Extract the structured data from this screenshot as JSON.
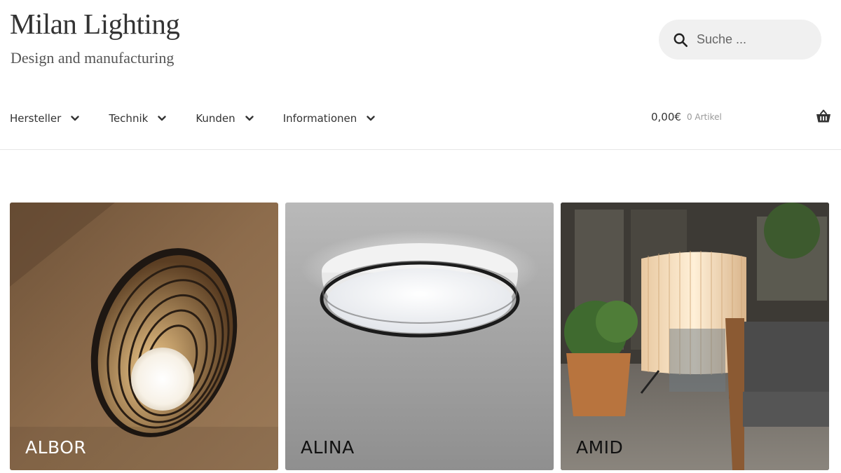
{
  "site": {
    "title": "Milan Lighting",
    "tagline": "Design and manufacturing"
  },
  "search": {
    "placeholder": "Suche ...",
    "value": "",
    "icon": "search-icon"
  },
  "nav": {
    "items": [
      {
        "label": "Hersteller",
        "icon": "chevron-down-icon"
      },
      {
        "label": "Technik",
        "icon": "chevron-down-icon"
      },
      {
        "label": "Kunden",
        "icon": "chevron-down-icon"
      },
      {
        "label": "Informationen",
        "icon": "chevron-down-icon"
      }
    ]
  },
  "cart": {
    "amount": "0,00€",
    "count": "0 Artikel",
    "icon": "basket-icon"
  },
  "products": [
    {
      "name": "ALBOR",
      "label_color": "#ffffff",
      "background": "#8a6a4a"
    },
    {
      "name": "ALINA",
      "label_color": "#111111",
      "background": "#9c9c9c"
    },
    {
      "name": "AMID",
      "label_color": "#111111",
      "background": "#4a4640"
    }
  ],
  "colors": {
    "text": "#333333",
    "muted": "#999999",
    "search_bg": "#f0f0f0",
    "divider": "#e6e6e6"
  }
}
